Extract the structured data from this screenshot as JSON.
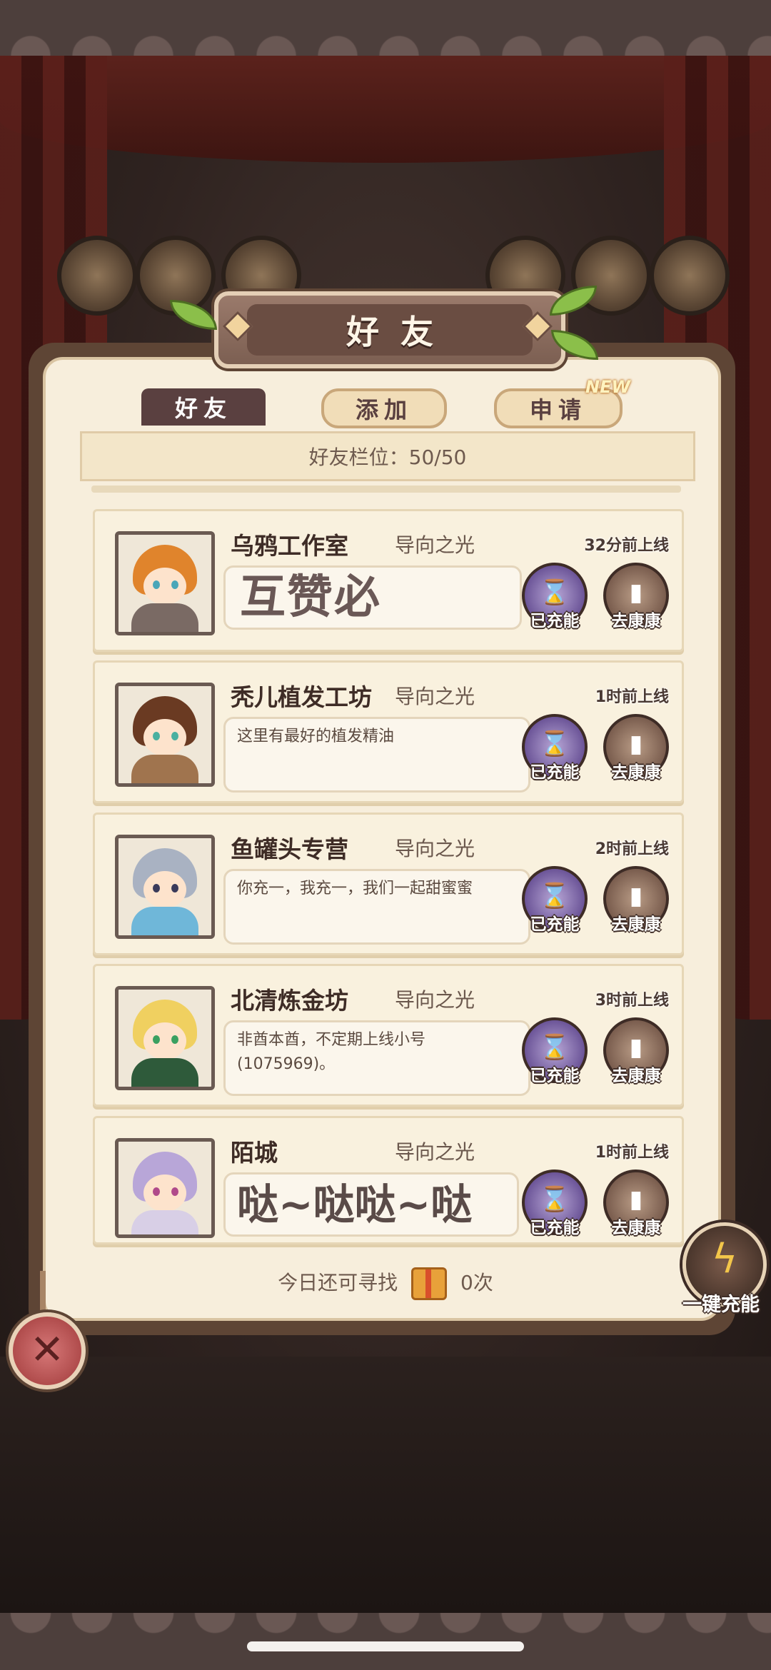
{
  "header": {
    "title": "好友"
  },
  "tabs": [
    {
      "label": "好友",
      "active": true
    },
    {
      "label": "添加",
      "active": false
    },
    {
      "label": "申请",
      "active": false,
      "badge": "NEW"
    }
  ],
  "slots": {
    "label": "好友栏位：50/50"
  },
  "friends": [
    {
      "name": "乌鸦工作室",
      "server": "导向之光",
      "last_online": "32分前上线",
      "message": "互赞必",
      "charge_label": "已充能",
      "visit_label": "去康康",
      "avatar_hair": "#e0842c",
      "avatar_body": "#7a6a64",
      "avatar_eye": "#4aa6b8"
    },
    {
      "name": "秃儿植发工坊",
      "server": "导向之光",
      "last_online": "1时前上线",
      "message": "这里有最好的植发精油",
      "charge_label": "已充能",
      "visit_label": "去康康",
      "avatar_hair": "#6a3a22",
      "avatar_body": "#a0744e",
      "avatar_eye": "#4ab0a0"
    },
    {
      "name": "鱼罐头专营",
      "server": "导向之光",
      "last_online": "2时前上线",
      "message": "你充一，我充一，我们一起甜蜜蜜",
      "charge_label": "已充能",
      "visit_label": "去康康",
      "avatar_hair": "#a9b2c2",
      "avatar_body": "#6fb7d9",
      "avatar_eye": "#3a3a5a"
    },
    {
      "name": "北清炼金坊",
      "server": "导向之光",
      "last_online": "3时前上线",
      "message": "非酋本酋，不定期上线小号(1075969)。",
      "charge_label": "已充能",
      "visit_label": "去康康",
      "avatar_hair": "#f0d060",
      "avatar_body": "#2e5a3a",
      "avatar_eye": "#3aa060"
    },
    {
      "name": "陌城",
      "server": "导向之光",
      "last_online": "1时前上线",
      "message": "哒~哒哒~哒",
      "charge_label": "已充能",
      "visit_label": "去康康",
      "avatar_hair": "#b8a6d8",
      "avatar_body": "#d8cfe6",
      "avatar_eye": "#b04a8a"
    }
  ],
  "footer": {
    "search_label": "今日还可寻找",
    "search_count": "0次"
  },
  "charge_all_label": "一键充能",
  "colors": {
    "panel_bg": "#f7eedc",
    "frame": "#5e4535",
    "accent_purple": "#6c5598"
  }
}
